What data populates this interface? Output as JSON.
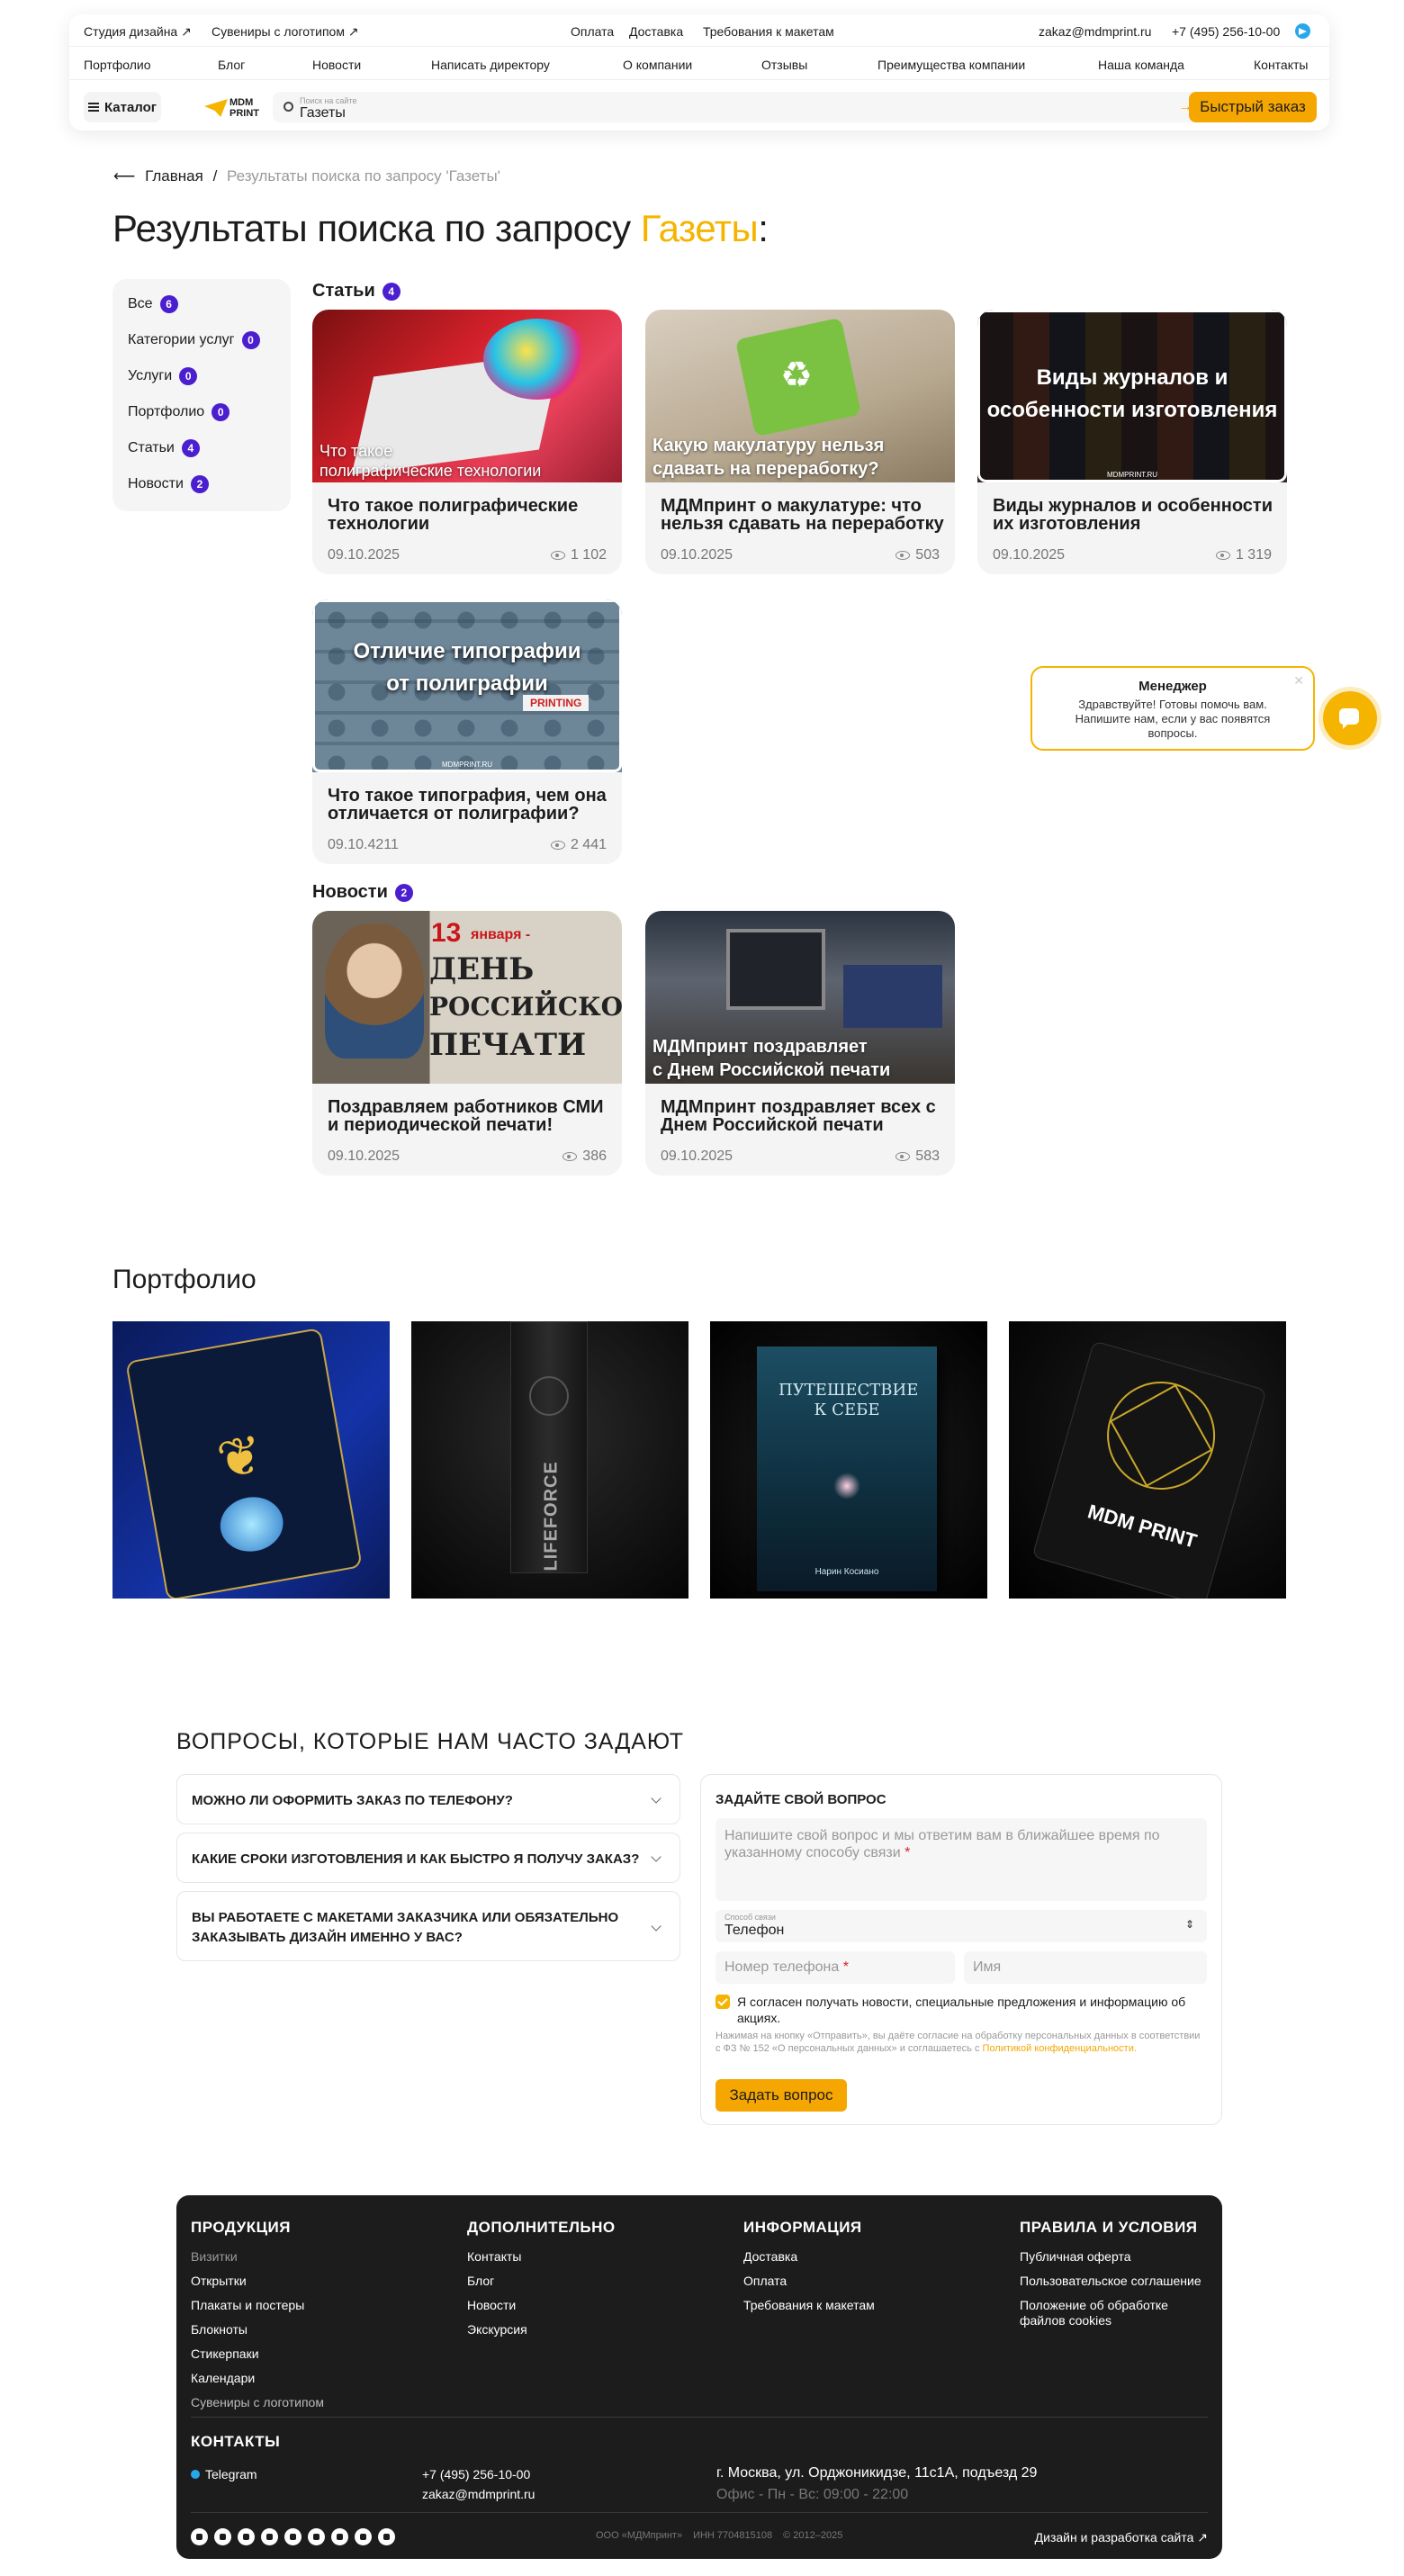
{
  "topbar": {
    "links_left": [
      "Студия дизайна ↗",
      "Сувениры с логотипом ↗"
    ],
    "links_center": [
      "Оплата",
      "Доставка",
      "Требования к макетам"
    ],
    "email": "zakaz@mdmprint.ru",
    "phone": "+7 (495) 256-10-00"
  },
  "nav": [
    "Портфолио",
    "Блог",
    "Новости",
    "Написать директору",
    "О компании",
    "Отзывы",
    "Преимущества компании",
    "Наша команда",
    "Контакты"
  ],
  "header": {
    "catalog": "Каталог",
    "logo_line1": "MDM",
    "logo_line2": "PRINT",
    "search_label": "Поиск на сайте",
    "search_value": "Газеты",
    "quick_order": "Быстрый заказ"
  },
  "breadcrumb": {
    "home": "Главная",
    "sep": "/",
    "current": "Результаты поиска по запросу 'Газеты'"
  },
  "page": {
    "title": "Результаты поиска по запросу",
    "query": "Газеты",
    "colon": ":"
  },
  "filters": [
    {
      "label": "Все",
      "count": "6"
    },
    {
      "label": "Категории услуг",
      "count": "0"
    },
    {
      "label": "Услуги",
      "count": "0"
    },
    {
      "label": "Портфолио",
      "count": "0"
    },
    {
      "label": "Статьи",
      "count": "4"
    },
    {
      "label": "Новости",
      "count": "2"
    }
  ],
  "articles": {
    "title": "Статьи",
    "count": "4",
    "items": [
      {
        "overlay": "Что такое\nполиграфические технологии",
        "title": "Что такое полиграфические технологии",
        "date": "09.10.2025",
        "views": "1 102"
      },
      {
        "overlay": "Какую макулатуру нельзя\nсдавать на переработку?",
        "title": "МДМпринт о макулатуре: что нельзя сдавать на переработку",
        "date": "09.10.2025",
        "views": "503"
      },
      {
        "overlay": "Виды журналов и\nособенности изготовления",
        "title": "Виды журналов и особенности их изготовления",
        "date": "09.10.2025",
        "views": "1 319",
        "site": "MDMPRINT.RU"
      },
      {
        "overlay": "Отличие типографии\nот полиграфии",
        "title": "Что такое типография, чем она отличается от полиграфии?",
        "date": "09.10.4211",
        "views": "2 441",
        "site": "MDMPRINT.RU",
        "tag": "PRINTING"
      }
    ]
  },
  "news": {
    "title": "Новости",
    "count": "2",
    "items": [
      {
        "overlay_date": "13",
        "overlay_month": "января -",
        "overlay_l1": "день",
        "overlay_l2": "российской",
        "overlay_l3": "печати",
        "title": "Поздравляем работников СМИ и периодической печати!",
        "date": "09.10.2025",
        "views": "386"
      },
      {
        "overlay": "МДМпринт поздравляет\nс Днем Российской печати",
        "title": "МДМпринт поздравляет всех с Днем Российской печати",
        "date": "09.10.2025",
        "views": "583"
      }
    ]
  },
  "manager": {
    "name": "Менеджер",
    "message": "Здравствуйте! Готовы помочь вам. Напишите нам, если у вас появятся вопросы."
  },
  "portfolio": {
    "title": "Портфолио",
    "item2_text": "LIFEFORCE",
    "item3_title": "ПУТЕШЕСТВИЕ К СЕБЕ",
    "item3_author": "Нарин Косиано",
    "item4_text": "MDM PRINT"
  },
  "faq": {
    "title": "ВОПРОСЫ, КОТОРЫЕ НАМ ЧАСТО ЗАДАЮТ",
    "items": [
      "МОЖНО ЛИ ОФОРМИТЬ ЗАКАЗ ПО ТЕЛЕФОНУ?",
      "КАКИЕ СРОКИ ИЗГОТОВЛЕНИЯ И КАК БЫСТРО Я ПОЛУЧУ ЗАКАЗ?",
      "ВЫ РАБОТАЕТЕ С МАКЕТАМИ ЗАКАЗЧИКА ИЛИ ОБЯЗАТЕЛЬНО ЗАКАЗЫВАТЬ ДИЗАЙН ИМЕННО У ВАС?"
    ]
  },
  "form": {
    "title": "ЗАДАЙТЕ СВОЙ ВОПРОС",
    "question_placeholder": "Напишите свой вопрос и мы ответим вам в ближайшее время по указанному способу связи",
    "contact_label": "Способ связи",
    "contact_value": "Телефон",
    "phone_placeholder": "Номер телефона",
    "name_placeholder": "Имя",
    "consent": "Я согласен получать новости, специальные предложения и информацию об акциях.",
    "legal": "Нажимая на кнопку «Отправить», вы даёте согласие на обработку персональных данных в соответствии с ФЗ № 152 «О персональных данных» и соглашаетесь с",
    "legal_link": "Политикой конфиденциальности.",
    "submit": "Задать вопрос"
  },
  "footer": {
    "products": {
      "title": "ПРОДУКЦИЯ",
      "links": [
        "Визитки",
        "Открытки",
        "Плакаты и постеры",
        "Блокноты",
        "Стикерпаки",
        "Календари",
        "Сувениры с логотипом"
      ]
    },
    "extra": {
      "title": "ДОПОЛНИТЕЛЬНО",
      "links": [
        "Контакты",
        "Блог",
        "Новости",
        "Экскурсия"
      ]
    },
    "info": {
      "title": "ИНФОРМАЦИЯ",
      "links": [
        "Доставка",
        "Оплата",
        "Требования к макетам"
      ]
    },
    "rules": {
      "title": "ПРАВИЛА И УСЛОВИЯ",
      "links": [
        "Публичная оферта",
        "Пользовательское соглашение",
        "Положение об обработке файлов cookies"
      ]
    },
    "contacts_title": "КОНТАКТЫ",
    "telegram": "Telegram",
    "phone": "+7 (495) 256-10-00",
    "email": "zakaz@mdmprint.ru",
    "address": "г. Москва, ул. Орджоникидзе, 11с1А, подъезд 29",
    "hours": "Офис - Пн - Вс: 09:00 - 22:00",
    "company": "ООО «МДМпринт»",
    "inn": "ИНН 7704815108",
    "copy": "© 2012–2025",
    "dev": "Дизайн и разработка сайта ↗"
  },
  "colors": {
    "accent": "#f5b400",
    "badge": "#4b1ecf",
    "footer": "#1c1c1c"
  }
}
